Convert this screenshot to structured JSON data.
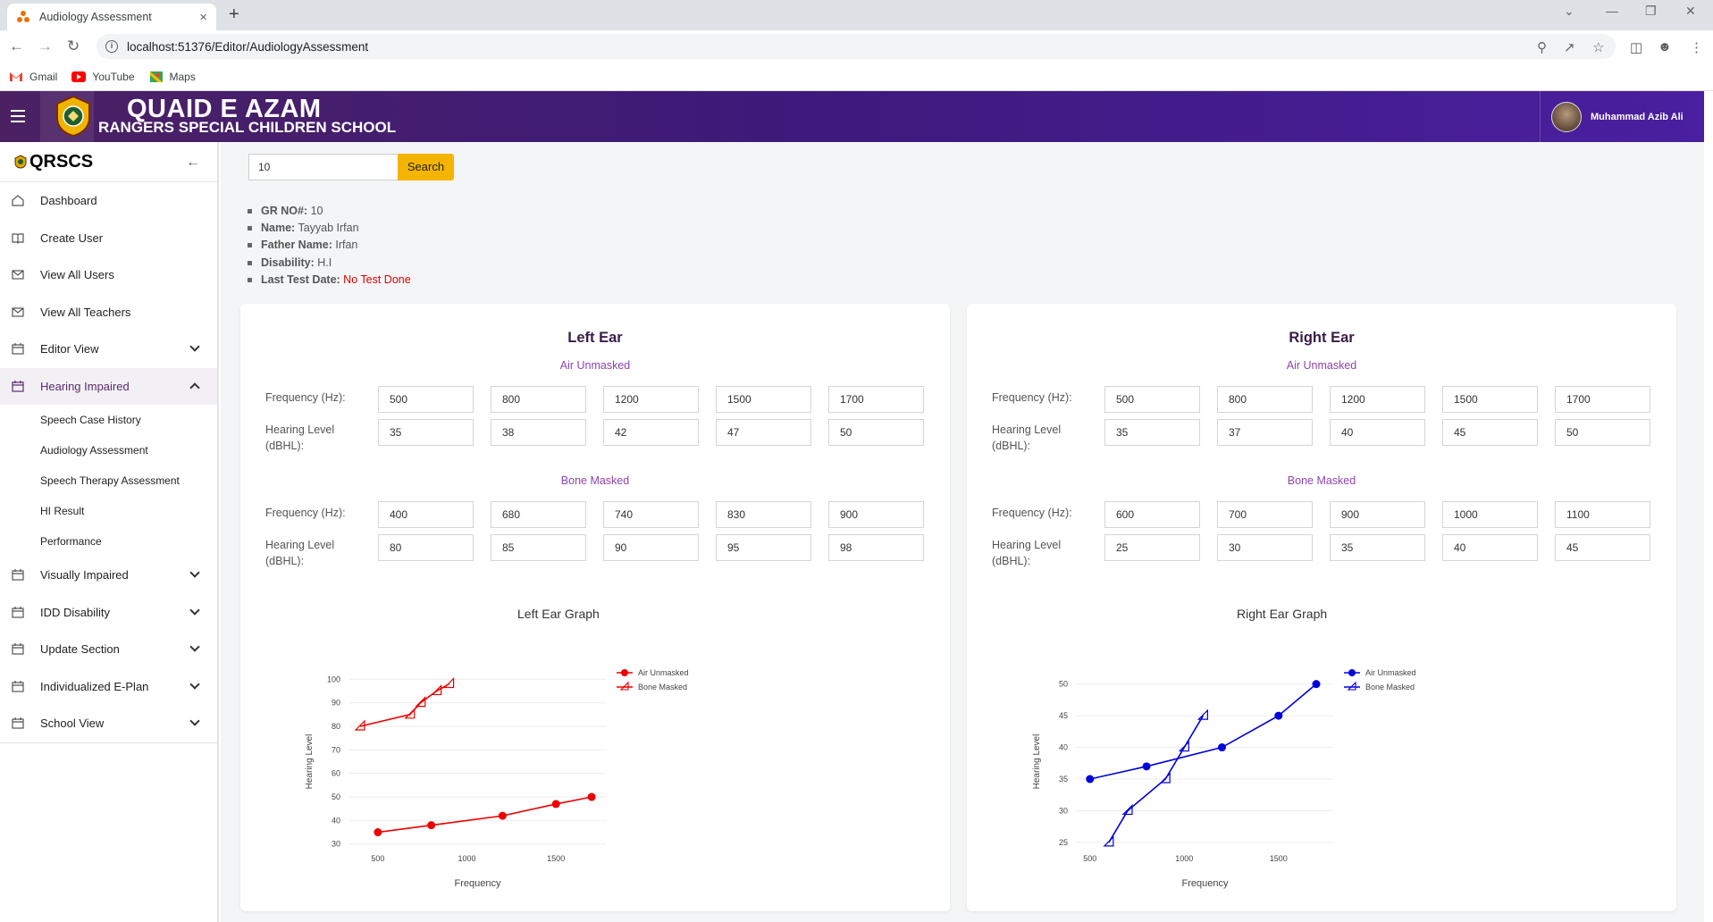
{
  "browser": {
    "tab_title": "Audiology Assessment",
    "tab_close": "×",
    "new_tab": "+",
    "url": "localhost:51376/Editor/AudiologyAssessment",
    "bookmarks": [
      {
        "label": "Gmail"
      },
      {
        "label": "YouTube"
      },
      {
        "label": "Maps"
      }
    ]
  },
  "header": {
    "brand_line1": "QUAID E AZAM",
    "brand_line2": "RANGERS SPECIAL CHILDREN SCHOOL",
    "user_name": "Muhammad Azib Ali"
  },
  "sidebar": {
    "brand": "QRSCS",
    "items": [
      {
        "label": "Dashboard"
      },
      {
        "label": "Create User"
      },
      {
        "label": "View All Users"
      },
      {
        "label": "View All Teachers"
      },
      {
        "label": "Editor View"
      },
      {
        "label": "Hearing Impaired"
      },
      {
        "label": "Visually Impaired"
      },
      {
        "label": "IDD Disability"
      },
      {
        "label": "Update Section"
      },
      {
        "label": "Individualized E-Plan"
      },
      {
        "label": "School View"
      }
    ],
    "sub_items": [
      {
        "label": "Speech Case History"
      },
      {
        "label": "Audiology Assessment"
      },
      {
        "label": "Speech Therapy Assessment"
      },
      {
        "label": "HI Result"
      },
      {
        "label": "Performance"
      }
    ]
  },
  "search": {
    "value": "10",
    "button_label": "Search"
  },
  "student": {
    "gr_label": "GR NO#:",
    "gr_value": "10",
    "name_label": "Name:",
    "name_value": "Tayyab Irfan",
    "father_label": "Father Name:",
    "father_value": "Irfan",
    "disability_label": "Disability:",
    "disability_value": "H.I",
    "last_test_label": "Last Test Date:",
    "last_test_value": "No Test Done"
  },
  "labels": {
    "air": "Air Unmasked",
    "bone": "Bone Masked",
    "freq": "Frequency (Hz):",
    "hearing": "Hearing Level (dBHL):"
  },
  "left_ear": {
    "title": "Left Ear",
    "air_freq": [
      "500",
      "800",
      "1200",
      "1500",
      "1700"
    ],
    "air_level": [
      "35",
      "38",
      "42",
      "47",
      "50"
    ],
    "bone_freq": [
      "400",
      "680",
      "740",
      "830",
      "900"
    ],
    "bone_level": [
      "80",
      "85",
      "90",
      "95",
      "98"
    ],
    "graph_title": "Left Ear Graph"
  },
  "right_ear": {
    "title": "Right Ear",
    "air_freq": [
      "500",
      "800",
      "1200",
      "1500",
      "1700"
    ],
    "air_level": [
      "35",
      "37",
      "40",
      "45",
      "50"
    ],
    "bone_freq": [
      "600",
      "700",
      "900",
      "1000",
      "1100"
    ],
    "bone_level": [
      "25",
      "30",
      "35",
      "40",
      "45"
    ],
    "graph_title": "Right Ear Graph"
  },
  "chart_data": [
    {
      "type": "line",
      "title": "Left Ear Graph",
      "xlabel": "Frequency",
      "ylabel": "Hearing Level",
      "xticks": [
        "500",
        "1000",
        "1500"
      ],
      "yticks": [
        "30",
        "40",
        "50",
        "60",
        "70",
        "80",
        "90",
        "100"
      ],
      "xlim": [
        340,
        1780
      ],
      "ylim": [
        28,
        102
      ],
      "legend": "top-right",
      "color": "#ee0000",
      "series": [
        {
          "name": "Air Unmasked",
          "marker": "circle",
          "x": [
            500,
            800,
            1200,
            1500,
            1700
          ],
          "y": [
            35,
            38,
            42,
            47,
            50
          ]
        },
        {
          "name": "Bone Masked",
          "marker": "open-triangle",
          "x": [
            400,
            680,
            740,
            830,
            900
          ],
          "y": [
            80,
            85,
            90,
            95,
            98
          ]
        }
      ]
    },
    {
      "type": "line",
      "title": "Right Ear Graph",
      "xlabel": "Frequency",
      "ylabel": "Hearing Level",
      "xticks": [
        "500",
        "1000",
        "1500"
      ],
      "yticks": [
        "25",
        "30",
        "35",
        "40",
        "45",
        "50"
      ],
      "xlim": [
        430,
        1790
      ],
      "ylim": [
        24,
        51.5
      ],
      "legend": "top-right",
      "color": "#0000dd",
      "series": [
        {
          "name": "Air Unmasked",
          "marker": "circle",
          "x": [
            500,
            800,
            1200,
            1500,
            1700
          ],
          "y": [
            35,
            37,
            40,
            45,
            50
          ]
        },
        {
          "name": "Bone Masked",
          "marker": "open-triangle",
          "x": [
            600,
            700,
            900,
            1000,
            1100
          ],
          "y": [
            25,
            30,
            35,
            40,
            45
          ]
        }
      ]
    }
  ]
}
